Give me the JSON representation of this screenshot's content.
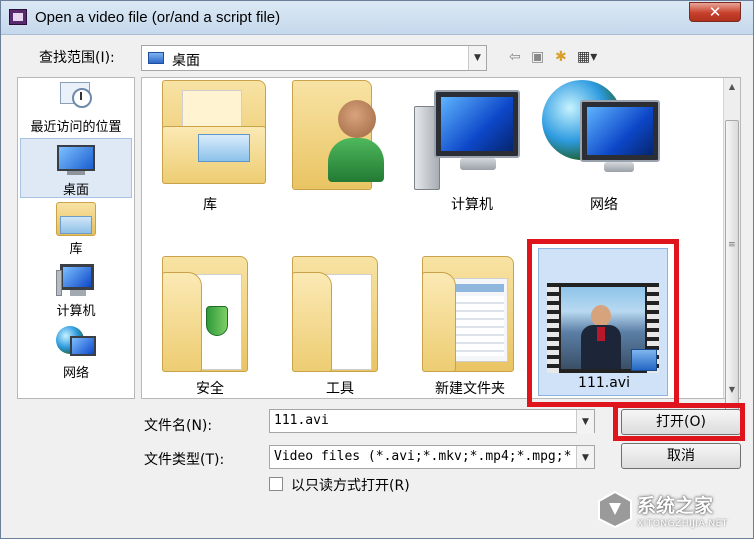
{
  "window": {
    "title": "Open a video file (or/and a script file)",
    "close_glyph": "✕"
  },
  "toolbar": {
    "lookin_label": "查找范围(I):",
    "lookin_value": "桌面",
    "back_glyph": "⇦",
    "up_glyph": "▣",
    "newfolder_glyph": "✱",
    "view_glyph": "▦▾"
  },
  "places": [
    {
      "label": "最近访问的位置",
      "icon": "recent-places-icon"
    },
    {
      "label": "桌面",
      "icon": "desktop-icon",
      "selected": true
    },
    {
      "label": "库",
      "icon": "libraries-icon"
    },
    {
      "label": "计算机",
      "icon": "computer-icon"
    },
    {
      "label": "网络",
      "icon": "network-icon"
    }
  ],
  "files": [
    {
      "label": "库",
      "icon": "libraries-folder-icon"
    },
    {
      "label": "",
      "icon": "user-folder-icon"
    },
    {
      "label": "计算机",
      "icon": "computer-icon"
    },
    {
      "label": "网络",
      "icon": "network-icon"
    },
    {
      "label": "安全",
      "icon": "folder-icon"
    },
    {
      "label": "工具",
      "icon": "folder-icon"
    },
    {
      "label": "新建文件夹",
      "icon": "folder-icon"
    },
    {
      "label": "111.avi",
      "icon": "video-thumbnail-icon",
      "selected": true
    }
  ],
  "scrollbar": {
    "up_glyph": "▲",
    "down_glyph": "▼",
    "grip_glyph": "≡"
  },
  "filename": {
    "label": "文件名(N):",
    "value": "111.avi"
  },
  "filetype": {
    "label": "文件类型(T):",
    "value": "Video files (*.avi;*.mkv;*.mp4;*.mpg;*"
  },
  "buttons": {
    "open": "打开(O)",
    "cancel": "取消"
  },
  "readonly": {
    "label": "以只读方式打开(R)",
    "checked": false
  },
  "combo_arrow": "▼",
  "watermark": {
    "text": "系统之家",
    "url": "XITONGZHIJIA.NET"
  },
  "colors": {
    "highlight_box": "#e0141c",
    "selection": "#cfe2f8"
  }
}
